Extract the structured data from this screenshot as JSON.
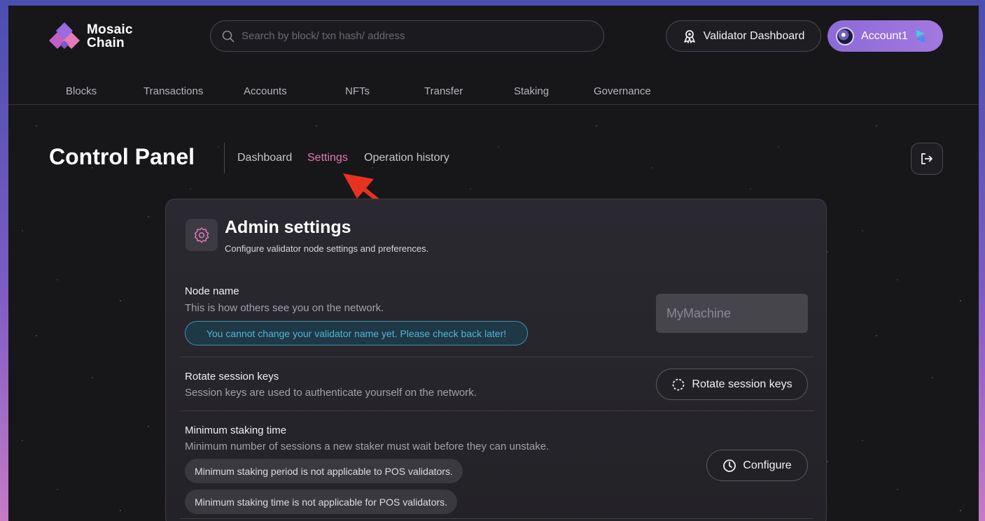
{
  "header": {
    "logo_line1": "Mosaic",
    "logo_line2": "Chain",
    "search_placeholder": "Search by block/ txn hash/ address",
    "validator_button": "Validator Dashboard",
    "account_button": "Account1"
  },
  "nav": {
    "items": [
      "Blocks",
      "Transactions",
      "Accounts",
      "NFTs",
      "Transfer",
      "Staking",
      "Governance"
    ]
  },
  "subheader": {
    "title": "Control Panel",
    "tabs": [
      "Dashboard",
      "Settings",
      "Operation history"
    ],
    "active_tab": "Settings"
  },
  "card": {
    "title": "Admin settings",
    "subtitle": "Configure validator node settings and preferences.",
    "node_name": {
      "label": "Node name",
      "description": "This is how others see you on the network.",
      "notice": "You cannot change your validator name yet. Please check back later!",
      "input_placeholder": "MyMachine"
    },
    "rotate": {
      "label": "Rotate session keys",
      "description": "Session keys are used to authenticate yourself on the network.",
      "button": "Rotate session keys"
    },
    "staking": {
      "label": "Minimum staking time",
      "description": "Minimum number of sessions a new staker must wait before they can unstake.",
      "note1": "Minimum staking period is not applicable to POS validators.",
      "note2": "Minimum staking time is not applicable for POS validators.",
      "button": "Configure"
    }
  },
  "colors": {
    "background": "#171619",
    "accent_pink": "#e37ab4",
    "account_purple": "#9a72dc",
    "notice_blue": "#4fb4d8",
    "annotation_red": "#e8321f"
  },
  "icons": [
    "mosaic-logo",
    "search-icon",
    "validator-icon",
    "account-avatar",
    "wallet-s-icon",
    "logout-icon",
    "gear-icon",
    "rotate-icon",
    "clock-icon",
    "annotation-arrow"
  ]
}
